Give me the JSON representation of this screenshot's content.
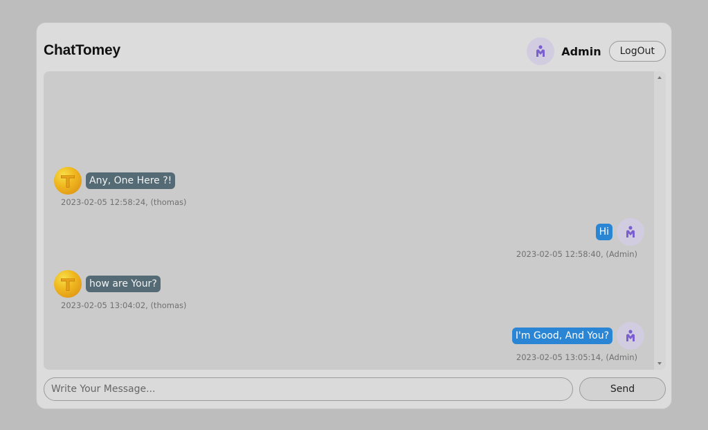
{
  "app": {
    "title": "ChatTomey"
  },
  "header": {
    "username": "Admin",
    "logout_label": "LogOut",
    "avatar_icon": "person-icon"
  },
  "messages": [
    {
      "direction": "incoming",
      "avatar_letter": "T",
      "text": "Any, One Here ?!",
      "meta": "2023-02-05 12:58:24, (thomas)"
    },
    {
      "direction": "outgoing",
      "avatar_icon": "person-icon",
      "text": "Hi",
      "meta": "2023-02-05 12:58:40, (Admin)"
    },
    {
      "direction": "incoming",
      "avatar_letter": "T",
      "text": "how are Your?",
      "meta": "2023-02-05 13:04:02, (thomas)"
    },
    {
      "direction": "outgoing",
      "avatar_icon": "person-icon",
      "text": "I'm Good, And You?",
      "meta": "2023-02-05 13:05:14, (Admin)"
    }
  ],
  "composer": {
    "placeholder": "Write Your Message...",
    "value": "",
    "send_label": "Send"
  },
  "colors": {
    "incoming_bubble": "#546a75",
    "outgoing_bubble": "#2a86d4",
    "avatar_admin_bg": "#d2cce0",
    "avatar_admin_fg": "#7b5fd0"
  }
}
